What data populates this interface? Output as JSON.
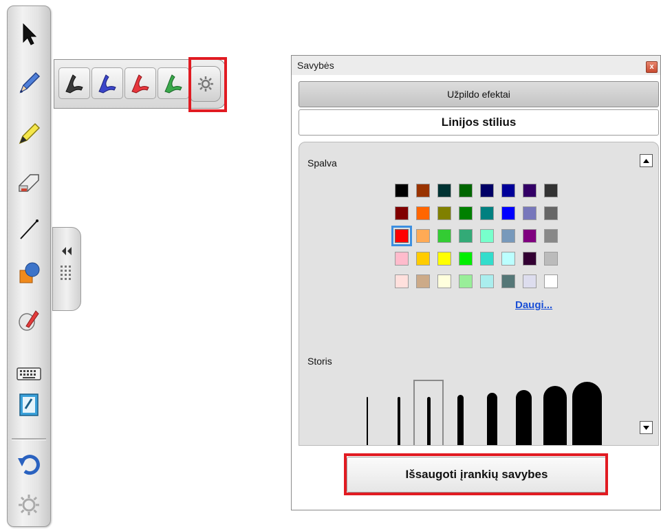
{
  "toolbar": {
    "tools": [
      "select-arrow-icon",
      "pen-icon",
      "highlighter-icon",
      "eraser-icon",
      "line-icon",
      "shapes-icon",
      "magic-pen-icon",
      "keyboard-icon",
      "notebook-icon",
      "undo-icon",
      "settings-icon"
    ]
  },
  "pen_flyout": {
    "pen_colors": [
      "#3b3b3b",
      "#3b45c9",
      "#e6363c",
      "#3aa84b"
    ]
  },
  "properties": {
    "title": "Savybės",
    "close_label": "x",
    "tab_fill_effects": "Užpildo efektai",
    "tab_line_style": "Linijos stilius",
    "color_label": "Spalva",
    "more_colors": "Daugi...",
    "width_label": "Storis",
    "save_button": "Išsaugoti įrankių savybes",
    "selected_color": "#ff0000",
    "selected_width_index": 2,
    "palette": [
      [
        "#000000",
        "#993300",
        "#003333",
        "#006600",
        "#000066",
        "#000099",
        "#330066",
        "#333333"
      ],
      [
        "#800000",
        "#ff6600",
        "#808000",
        "#008000",
        "#008080",
        "#0000ff",
        "#7777bb",
        "#666666"
      ],
      [
        "#ff0000",
        "#ffaa55",
        "#33cc33",
        "#33aa77",
        "#77ffcc",
        "#7799bb",
        "#800080",
        "#888888"
      ],
      [
        "#ffbbcc",
        "#ffcc00",
        "#ffff00",
        "#00ee00",
        "#33ddcc",
        "#bbffff",
        "#330033",
        "#bbbbbb"
      ],
      [
        "#ffe0dd",
        "#ccaa88",
        "#ffffdd",
        "#99ee99",
        "#aaeeee",
        "#557777",
        "#ddddee",
        "#ffffff"
      ]
    ]
  }
}
